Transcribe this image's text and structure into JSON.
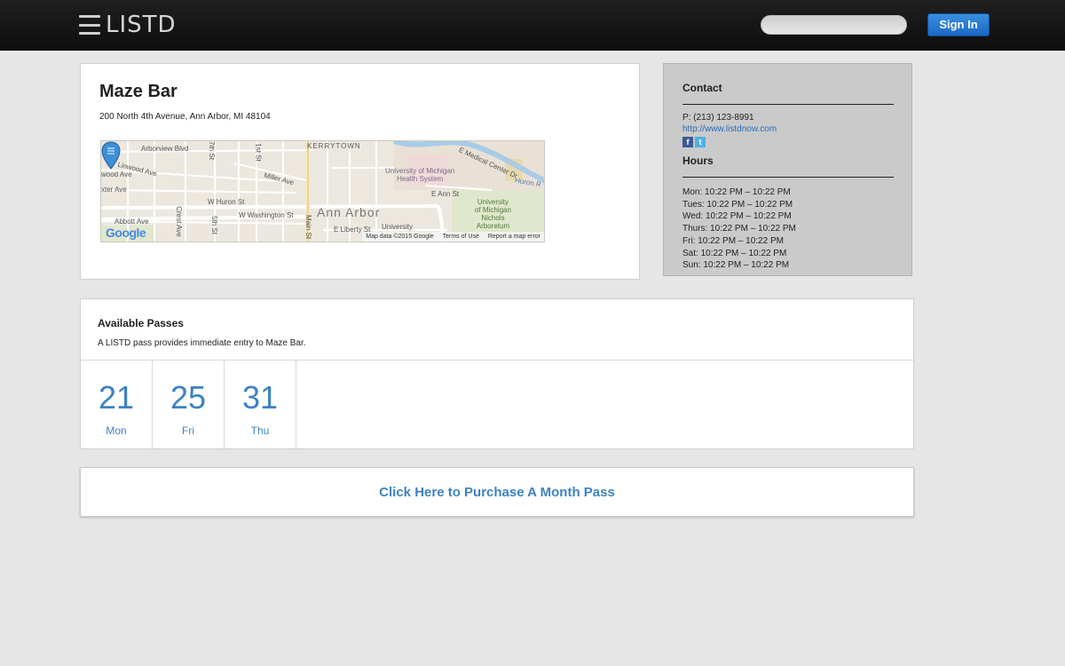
{
  "header": {
    "logo_text": "LISTD",
    "search_placeholder": "",
    "signin_label": "Sign In"
  },
  "venue": {
    "name": "Maze Bar",
    "address": "200 North 4th Avenue, Ann Arbor, MI 48104",
    "map": {
      "labels": {
        "arborview": "Arborview Blvd",
        "kerrytown": "KERRYTOWN",
        "linwood": "Linwood Ave",
        "wood": "wood Ave",
        "exter": "xter Ave",
        "miller": "Miller Ave",
        "huron": "W Huron St",
        "washington": "W Washington St",
        "ann_arbor": "Ann Arbor",
        "abbott": "Abbott Ave",
        "crest": "Crest Ave",
        "fifth": "5th St",
        "seventh": "7th St",
        "main": "Main St",
        "first": "1st St",
        "umich_health": "University of Michigan\nHealth System",
        "e_medical": "E Medical Center Dr",
        "e_ann": "E Ann St",
        "huron_river": "Huron R",
        "arboretum": "University\nof Michigan\nNichols\nArboretum",
        "liberty": "E Liberty St",
        "university": "University"
      },
      "google": "Google",
      "footer_data": "Map data ©2015 Google",
      "footer_terms": "Terms of Use",
      "footer_report": "Report a map error"
    }
  },
  "contact": {
    "heading": "Contact",
    "phone": "P: (213) 123-8991",
    "url": "http://www.listdnow.com",
    "social": {
      "facebook": "f",
      "twitter": "t"
    },
    "hours_heading": "Hours",
    "hours": [
      "Mon: 10:22 PM – 10:22 PM",
      "Tues: 10:22 PM – 10:22 PM",
      "Wed: 10:22 PM – 10:22 PM",
      "Thurs: 10:22 PM – 10:22 PM",
      "Fri: 10:22 PM – 10:22 PM",
      "Sat: 10:22 PM – 10:22 PM",
      "Sun: 10:22 PM – 10:22 PM"
    ]
  },
  "passes": {
    "title": "Available Passes",
    "description": "A LISTD pass provides immediate entry to Maze Bar.",
    "days": [
      {
        "num": "21",
        "dow": "Mon"
      },
      {
        "num": "25",
        "dow": "Fri"
      },
      {
        "num": "31",
        "dow": "Thu"
      }
    ]
  },
  "purchase": {
    "label": "Click Here to Purchase A Month Pass"
  },
  "colors": {
    "accent": "#3d82c2",
    "topbar": "#141414",
    "background": "#e6e6e6",
    "contact_bg": "#cacaca",
    "signin": "#1f6fcb"
  }
}
